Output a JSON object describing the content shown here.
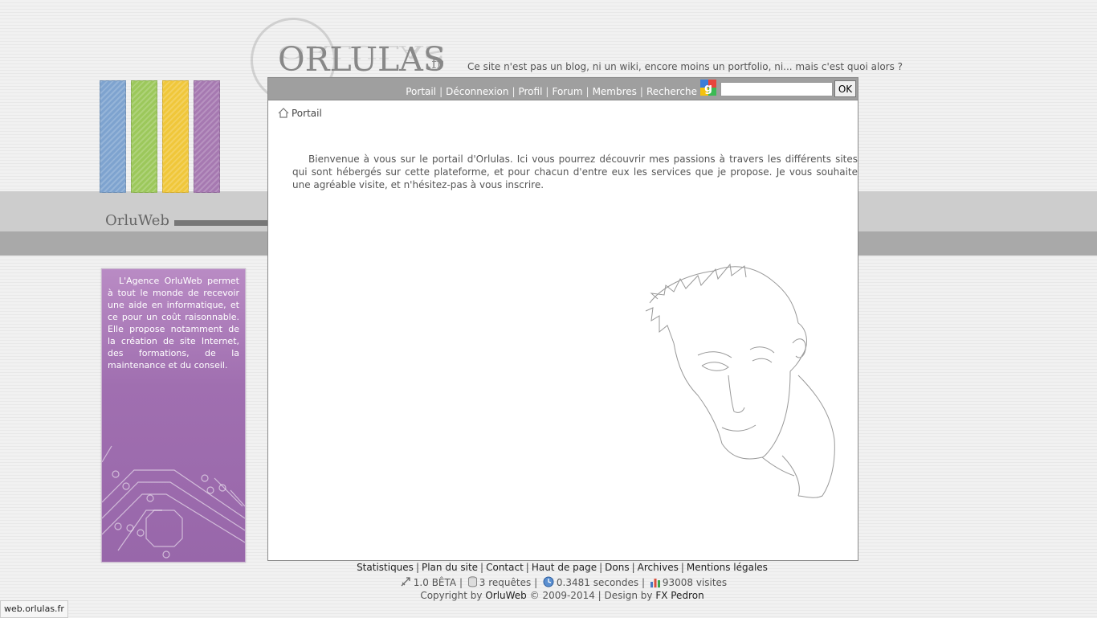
{
  "logo": {
    "name": "ORLULAS",
    "tld": ".fr"
  },
  "tagline": "Ce site n'est pas un blog, ni un wiki, encore moins un portfolio, ni... mais c'est quoi alors ?",
  "nav": {
    "items": [
      "Portail",
      "Déconnexion",
      "Profil",
      "Forum",
      "Membres",
      "Recherche"
    ],
    "search_value": "",
    "search_button": "OK"
  },
  "breadcrumb": "Portail",
  "welcome": "Bienvenue à vous sur le portail d'Orlulas. Ici vous pourrez découvrir mes passions à travers les différents sites qui sont hébergés sur cette plateforme, et pour chacun d'entre eux les services que je propose. Je vous souhaite une agréable visite, et n'hésitez-pas à vous inscrire.",
  "section_label": "OrluWeb",
  "sidebar": {
    "text": "L'Agence OrluWeb permet à tout le monde de recevoir une aide en informatique, et ce pour un coût raisonnable. Elle propose notamment de la création de site Internet, des formations, de la maintenance et du conseil."
  },
  "footer": {
    "links": [
      "Statistiques",
      "Plan du site",
      "Contact",
      "Haut de page",
      "Dons",
      "Archives",
      "Mentions légales"
    ],
    "version": "1.0 BÊTA",
    "queries": "3 requêtes",
    "time": "0.3481 secondes",
    "visits": "93008 visites",
    "copyright_prefix": "Copyright by",
    "copyright_brand": "OrluWeb",
    "copyright_years": "© 2009-2014 | Design by",
    "designer": "FX Pedron"
  },
  "status_bar_url": "web.orlulas.fr",
  "colors": {
    "blue": "#7ea3cf",
    "green": "#9cc85b",
    "yellow": "#f0c73a",
    "purple": "#a679b1",
    "sidebar": "#a06fb0"
  }
}
